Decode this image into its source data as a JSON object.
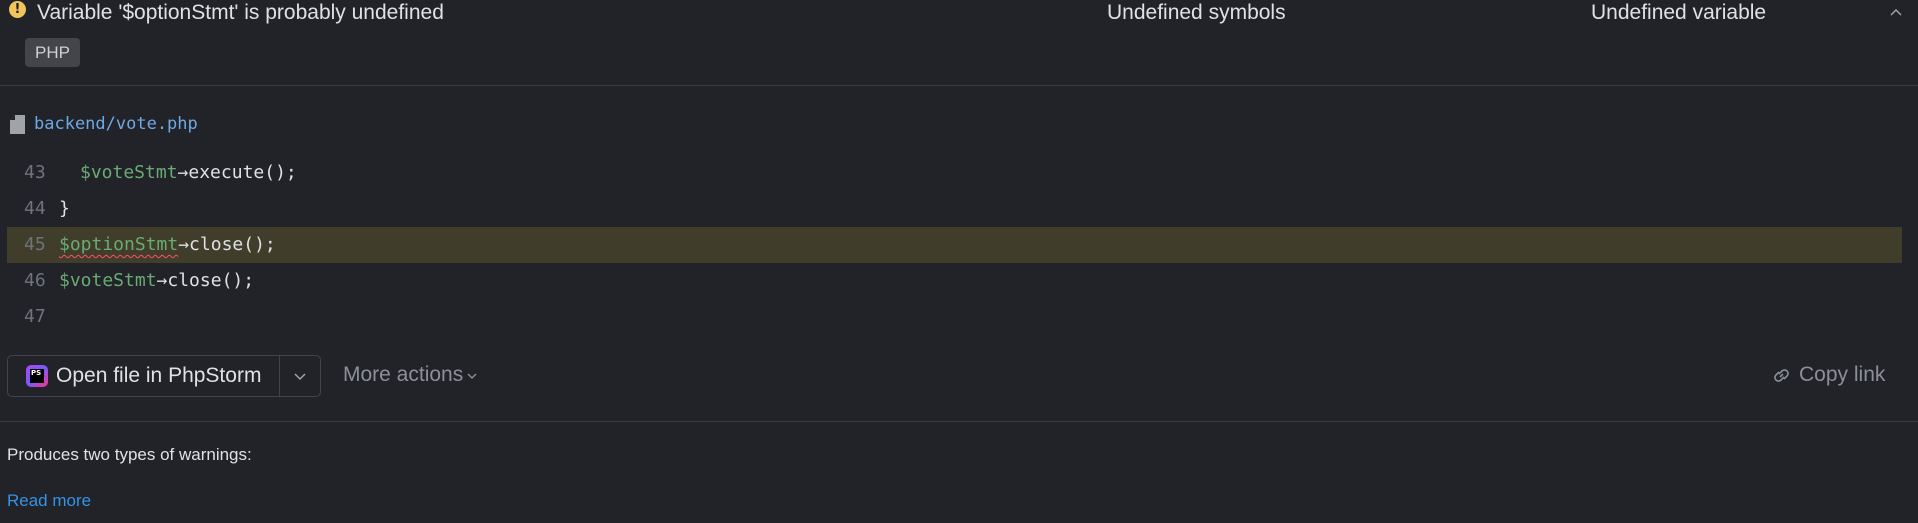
{
  "problem": {
    "title": "Variable '$optionStmt' is probably undefined",
    "category": "Undefined symbols",
    "inspection": "Undefined variable",
    "language_tag": "PHP"
  },
  "file": {
    "path": "backend/vote.php"
  },
  "code": {
    "lines": [
      {
        "number": "43",
        "var": "$voteStmt",
        "rest": "→execute();"
      },
      {
        "number": "44",
        "text": "}"
      },
      {
        "number": "45",
        "var": "$optionStmt",
        "rest": "→close();"
      },
      {
        "number": "46",
        "var": "$voteStmt",
        "rest": "→close();"
      },
      {
        "number": "47",
        "text": ""
      }
    ]
  },
  "actions": {
    "open_label": "Open file in PhpStorm",
    "more_actions_label": "More actions",
    "copy_link_label": "Copy link"
  },
  "description": {
    "text": "Produces two types of warnings:",
    "read_more_label": "Read more"
  },
  "icons": {
    "warning": "warning-icon",
    "collapse": "chevron-up-icon",
    "file": "file-icon",
    "ide": "phpstorm-icon",
    "dropdown": "chevron-down-icon",
    "link": "link-icon"
  },
  "colors": {
    "background": "#212328",
    "warning": "#f2c55c",
    "highlight": "#403d2b",
    "variable": "#6aab73",
    "link": "#3592e6",
    "file_path": "#6ea8e5"
  }
}
